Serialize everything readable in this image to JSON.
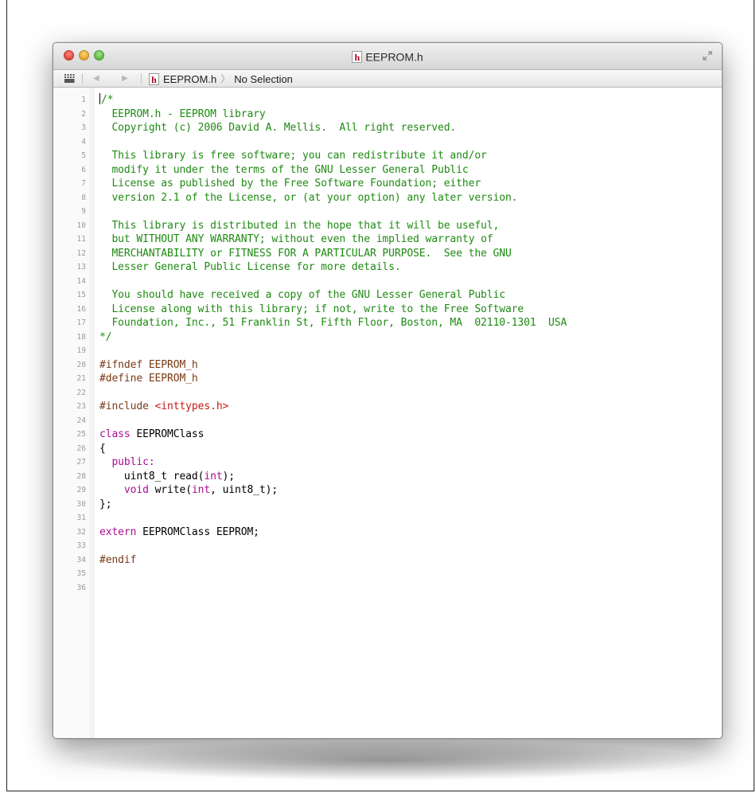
{
  "window": {
    "title": "EEPROM.h",
    "file_icon_glyph": "h"
  },
  "jumpbar": {
    "file_label": "EEPROM.h",
    "separator_glyph": "〉",
    "selection_label": "No Selection",
    "back_glyph": "◀",
    "forward_glyph": "▶"
  },
  "editor": {
    "line_numbers": [
      "1",
      "2",
      "3",
      "4",
      "5",
      "6",
      "7",
      "8",
      "9",
      "10",
      "11",
      "12",
      "13",
      "14",
      "15",
      "16",
      "17",
      "18",
      "19",
      "20",
      "21",
      "22",
      "23",
      "24",
      "25",
      "26",
      "27",
      "28",
      "29",
      "30",
      "31",
      "32",
      "33",
      "34",
      "35",
      "36"
    ],
    "lines": [
      [
        {
          "t": "/*",
          "c": "comment"
        }
      ],
      [
        {
          "t": "  EEPROM.h - EEPROM library",
          "c": "comment"
        }
      ],
      [
        {
          "t": "  Copyright (c) 2006 David A. Mellis.  All right reserved.",
          "c": "comment"
        }
      ],
      [],
      [
        {
          "t": "  This library is free software; you can redistribute it and/or",
          "c": "comment"
        }
      ],
      [
        {
          "t": "  modify it under the terms of the GNU Lesser General Public",
          "c": "comment"
        }
      ],
      [
        {
          "t": "  License as published by the Free Software Foundation; either",
          "c": "comment"
        }
      ],
      [
        {
          "t": "  version 2.1 of the License, or (at your option) any later version.",
          "c": "comment"
        }
      ],
      [],
      [
        {
          "t": "  This library is distributed in the hope that it will be useful,",
          "c": "comment"
        }
      ],
      [
        {
          "t": "  but WITHOUT ANY WARRANTY; without even the implied warranty of",
          "c": "comment"
        }
      ],
      [
        {
          "t": "  MERCHANTABILITY or FITNESS FOR A PARTICULAR PURPOSE.  See the GNU",
          "c": "comment"
        }
      ],
      [
        {
          "t": "  Lesser General Public License for more details.",
          "c": "comment"
        }
      ],
      [],
      [
        {
          "t": "  You should have received a copy of the GNU Lesser General Public",
          "c": "comment"
        }
      ],
      [
        {
          "t": "  License along with this library; if not, write to the Free Software",
          "c": "comment"
        }
      ],
      [
        {
          "t": "  Foundation, Inc., 51 Franklin St, Fifth Floor, Boston, MA  02110-1301  USA",
          "c": "comment"
        }
      ],
      [
        {
          "t": "*/",
          "c": "comment"
        }
      ],
      [],
      [
        {
          "t": "#ifndef EEPROM_h",
          "c": "pre"
        }
      ],
      [
        {
          "t": "#define EEPROM_h",
          "c": "pre"
        }
      ],
      [],
      [
        {
          "t": "#include ",
          "c": "pre"
        },
        {
          "t": "<inttypes.h>",
          "c": "inc"
        }
      ],
      [],
      [
        {
          "t": "class",
          "c": "kw"
        },
        {
          "t": " EEPROMClass",
          "c": "plain"
        }
      ],
      [
        {
          "t": "{",
          "c": "plain"
        }
      ],
      [
        {
          "t": "  public:",
          "c": "kw"
        }
      ],
      [
        {
          "t": "    uint8_t read(",
          "c": "plain"
        },
        {
          "t": "int",
          "c": "kw"
        },
        {
          "t": ");",
          "c": "plain"
        }
      ],
      [
        {
          "t": "    ",
          "c": "plain"
        },
        {
          "t": "void",
          "c": "kw"
        },
        {
          "t": " write(",
          "c": "plain"
        },
        {
          "t": "int",
          "c": "kw"
        },
        {
          "t": ", uint8_t);",
          "c": "plain"
        }
      ],
      [
        {
          "t": "};",
          "c": "plain"
        }
      ],
      [],
      [
        {
          "t": "extern",
          "c": "kw"
        },
        {
          "t": " EEPROMClass EEPROM;",
          "c": "plain"
        }
      ],
      [],
      [
        {
          "t": "#endif",
          "c": "pre"
        }
      ],
      [],
      []
    ]
  },
  "colors": {
    "comment": "#1e8a12",
    "preprocessor": "#7a3a16",
    "include_string": "#c41a16",
    "keyword": "#aa0d91",
    "plain": "#000000"
  },
  "icons": {
    "close": "close-button",
    "minimize": "minimize-button",
    "zoom": "zoom-button",
    "related_items": "grid-icon",
    "fullscreen": "fullscreen-icon",
    "file": "header-file-icon"
  }
}
